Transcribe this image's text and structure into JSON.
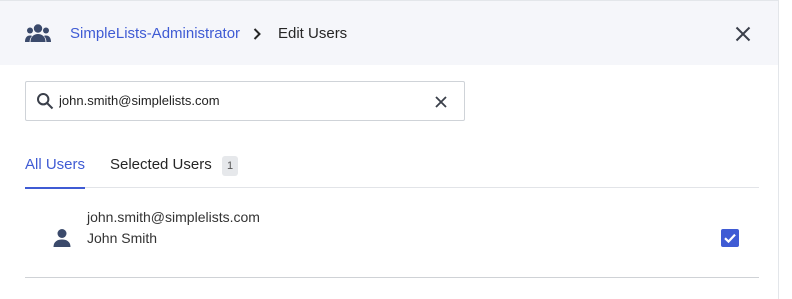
{
  "header": {
    "icon": "group-icon",
    "breadcrumb_link": "SimpleLists-Administrator",
    "separator_icon": "chevron-right-icon",
    "breadcrumb_current": "Edit Users",
    "close_icon": "close-icon"
  },
  "search": {
    "value": "john.smith@simplelists.com",
    "icon": "search-icon",
    "clear_icon": "clear-icon"
  },
  "tabs": [
    {
      "label": "All Users",
      "active": true
    },
    {
      "label": "Selected Users",
      "active": false,
      "count": "1"
    }
  ],
  "results": [
    {
      "email": "john.smith@simplelists.com",
      "name": "John Smith",
      "icon": "person-icon",
      "selected": true
    }
  ],
  "colors": {
    "accent": "#3f5bd4",
    "header_bg": "#f5f6fa",
    "icon": "#3b4a6b"
  }
}
